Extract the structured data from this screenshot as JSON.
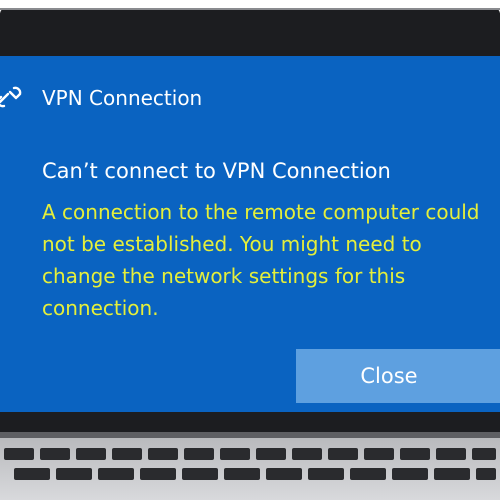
{
  "notification": {
    "app_name": "VPN Connection",
    "heading": "Can’t connect to VPN Connection",
    "message_lines": [
      "A connection to the remote computer could",
      "not be established.  You might need to",
      "change the network settings for this",
      "connection."
    ],
    "close_label": "Close",
    "app_icon": "vpn-link-icon"
  },
  "colors": {
    "panel_background": "#0a63c1",
    "message_text": "#e5ef3a",
    "button_background": "#5ea0e0",
    "title_text": "#ffffff"
  }
}
